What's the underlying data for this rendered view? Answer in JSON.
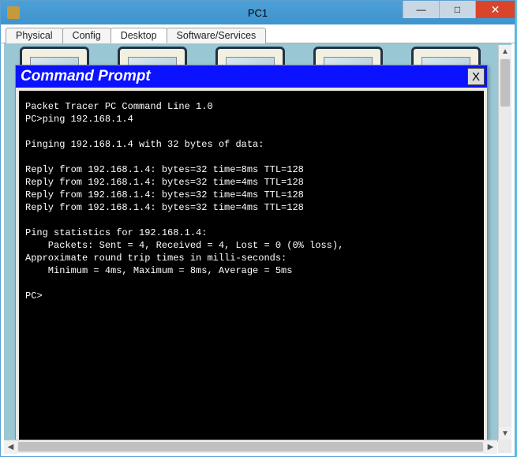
{
  "window": {
    "title": "PC1",
    "controls": {
      "min": "—",
      "max": "□",
      "close": "✕"
    }
  },
  "tabs": [
    "Physical",
    "Config",
    "Desktop",
    "Software/Services"
  ],
  "active_tab_index": 2,
  "cmd": {
    "title": "Command Prompt",
    "close_label": "X",
    "lines": [
      "Packet Tracer PC Command Line 1.0",
      "PC>ping 192.168.1.4",
      "",
      "Pinging 192.168.1.4 with 32 bytes of data:",
      "",
      "Reply from 192.168.1.4: bytes=32 time=8ms TTL=128",
      "Reply from 192.168.1.4: bytes=32 time=4ms TTL=128",
      "Reply from 192.168.1.4: bytes=32 time=4ms TTL=128",
      "Reply from 192.168.1.4: bytes=32 time=4ms TTL=128",
      "",
      "Ping statistics for 192.168.1.4:",
      "    Packets: Sent = 4, Received = 4, Lost = 0 (0% loss),",
      "Approximate round trip times in milli-seconds:",
      "    Minimum = 4ms, Maximum = 8ms, Average = 5ms",
      "",
      "PC>"
    ]
  }
}
